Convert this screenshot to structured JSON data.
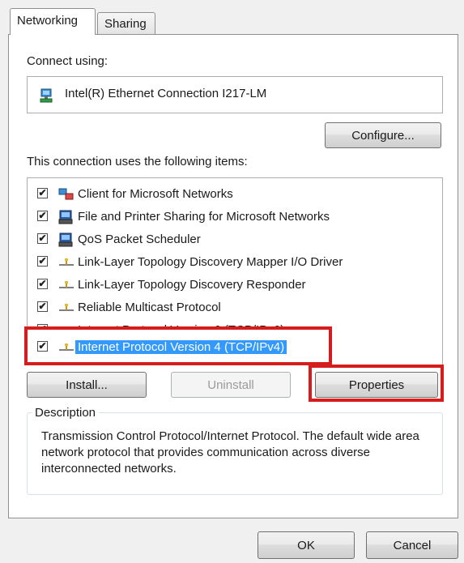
{
  "tabs": [
    {
      "label": "Networking",
      "active": true
    },
    {
      "label": "Sharing",
      "active": false
    }
  ],
  "connect_using": {
    "label": "Connect using:",
    "adapter": "Intel(R) Ethernet Connection I217-LM",
    "adapter_icon": "network-adapter-icon"
  },
  "configure_button": "Configure...",
  "items_label": "This connection uses the following items:",
  "items": [
    {
      "label": "Client for Microsoft Networks",
      "checked": true,
      "icon": "client-network-icon"
    },
    {
      "label": "File and Printer Sharing for Microsoft Networks",
      "checked": true,
      "icon": "service-icon"
    },
    {
      "label": "QoS Packet Scheduler",
      "checked": true,
      "icon": "service-icon"
    },
    {
      "label": "Link-Layer Topology Discovery Mapper I/O Driver",
      "checked": true,
      "icon": "protocol-icon"
    },
    {
      "label": "Link-Layer Topology Discovery Responder",
      "checked": true,
      "icon": "protocol-icon"
    },
    {
      "label": "Reliable Multicast Protocol",
      "checked": true,
      "icon": "protocol-icon"
    },
    {
      "label": "Internet Protocol Version 6 (TCP/IPv6)",
      "checked": true,
      "icon": "protocol-icon"
    },
    {
      "label": "Internet Protocol Version 4 (TCP/IPv4)",
      "checked": true,
      "icon": "protocol-icon",
      "selected": true
    }
  ],
  "buttons": {
    "install": "Install...",
    "uninstall": "Uninstall",
    "properties": "Properties",
    "ok": "OK",
    "cancel": "Cancel"
  },
  "description": {
    "legend": "Description",
    "text": "Transmission Control Protocol/Internet Protocol. The default wide area network protocol that provides communication across diverse interconnected networks."
  },
  "colors": {
    "highlight": "#d61c1c",
    "selection": "#3399ff"
  }
}
